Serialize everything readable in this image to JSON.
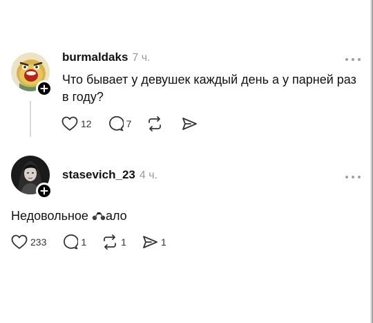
{
  "posts": [
    {
      "username": "burmaldaks",
      "time": "7 ч.",
      "text": "Что бывает у девушек каждый день а у парней раз в году?",
      "likes": "12",
      "replies": "7",
      "reposts": "",
      "shares": "",
      "avatar_icon": "angry-cartoon-avatar"
    },
    {
      "username": "stasevich_23",
      "time": "4 ч.",
      "text_before": "Недовольное ",
      "text_emoji": "motorcycle-emoji",
      "text_after": "ало",
      "likes": "233",
      "replies": "1",
      "reposts": "1",
      "shares": "1",
      "avatar_icon": "photo-avatar"
    }
  ],
  "icons": {
    "like": "heart-icon",
    "reply": "comment-icon",
    "repost": "repost-icon",
    "share": "send-icon",
    "follow": "plus-icon",
    "more": "more-icon"
  },
  "colors": {
    "text": "#111111",
    "muted": "#9a9a9a",
    "icon": "#333333",
    "badge": "#000000"
  }
}
